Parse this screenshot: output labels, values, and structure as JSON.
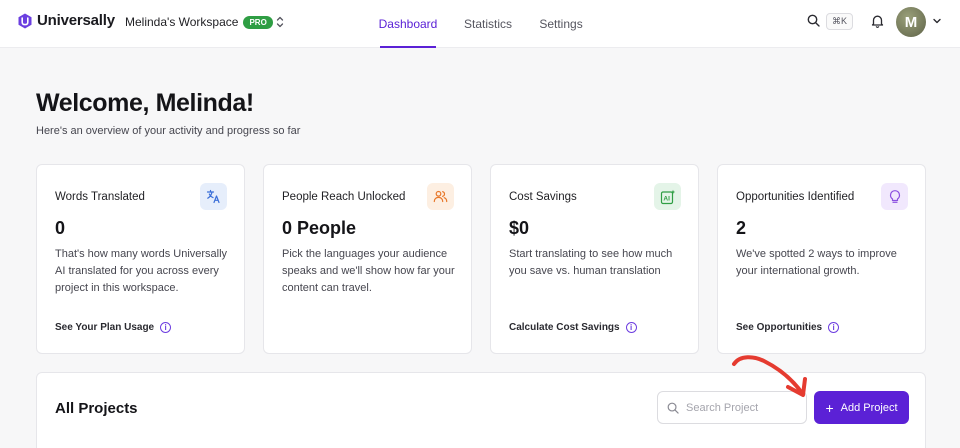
{
  "brand": {
    "name": "Universally",
    "color": "#6b3fe0"
  },
  "workspace": {
    "name": "Melinda's Workspace",
    "badge": "PRO"
  },
  "nav": {
    "items": [
      "Dashboard",
      "Statistics",
      "Settings"
    ],
    "active": "Dashboard"
  },
  "header": {
    "shortcut": "⌘K",
    "avatar_initial": "M"
  },
  "welcome": {
    "title": "Welcome, Melinda!",
    "subtitle": "Here's an overview of your activity and progress so far"
  },
  "cards": [
    {
      "title": "Words Translated",
      "value": "0",
      "description": "That's how many words Universally AI translated for you across every project in this workspace.",
      "link": "See Your Plan Usage",
      "icon": "translate-icon",
      "color": "#3b6fd8"
    },
    {
      "title": "People Reach Unlocked",
      "value": "0 People",
      "description": "Pick the languages your audience speaks and we'll show how far your content can travel.",
      "link": "",
      "icon": "users-icon",
      "color": "#e8782a"
    },
    {
      "title": "Cost Savings",
      "value": "$0",
      "description": "Start translating to see how much you save vs. human translation",
      "link": "Calculate Cost Savings",
      "icon": "ai-icon",
      "color": "#2f9e44"
    },
    {
      "title": "Opportunities Identified",
      "value": "2",
      "description": "We've spotted 2 ways to improve your international growth.",
      "link": "See Opportunities",
      "icon": "lightbulb-icon",
      "color": "#8b4fe0"
    }
  ],
  "projects": {
    "title": "All Projects",
    "search_placeholder": "Search Project",
    "add_label": "Add Project"
  },
  "colors": {
    "accent": "#5b21d6",
    "annotation_arrow": "#e53b30"
  }
}
